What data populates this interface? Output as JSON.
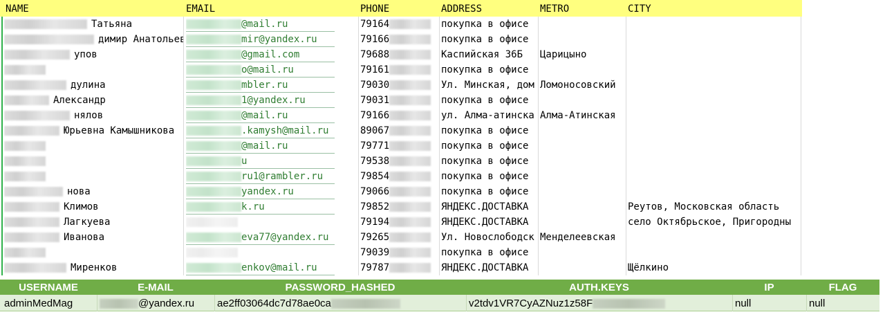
{
  "top_table": {
    "headers": [
      "NAME",
      "EMAIL",
      "PHONE",
      "ADDRESS",
      "METRO",
      "CITY"
    ],
    "rows": [
      {
        "name": "Татьяна",
        "email": "@mail.ru",
        "phone": "79164",
        "address": "покупка в офисе",
        "metro": "",
        "city": ""
      },
      {
        "name": "димир Анатольевич",
        "email": "mir@yandex.ru",
        "phone": "79166",
        "address": "покупка в офисе",
        "metro": "",
        "city": ""
      },
      {
        "name": "упов",
        "email": "@gmail.com",
        "phone": "79688",
        "address": "Каспийская 36Б",
        "metro": "Царицыно",
        "city": ""
      },
      {
        "name": "",
        "email": "o@mail.ru",
        "phone": "79161",
        "address": "покупка в офисе",
        "metro": "",
        "city": ""
      },
      {
        "name": "дулина",
        "email": "mbler.ru",
        "phone": "79030",
        "address": "Ул. Минская, дом",
        "metro": "Ломоносовский",
        "city": ""
      },
      {
        "name": "Александр",
        "email": "1@yandex.ru",
        "phone": "79031",
        "address": "покупка в офисе",
        "metro": "",
        "city": ""
      },
      {
        "name": "нялов",
        "email": "@mail.ru",
        "phone": "79166",
        "address": "ул. Алма-атинска",
        "metro": "Алма-Атинская",
        "city": ""
      },
      {
        "name": "Юрьевна Камышникова",
        "email": ".kamysh@mail.ru",
        "phone": "89067",
        "address": "покупка в офисе",
        "metro": "",
        "city": ""
      },
      {
        "name": "",
        "email": "@mail.ru",
        "phone": "79771",
        "address": "покупка в офисе",
        "metro": "",
        "city": ""
      },
      {
        "name": "",
        "email": "u",
        "phone": "79538",
        "address": "покупка в офисе",
        "metro": "",
        "city": ""
      },
      {
        "name": "",
        "email": "ru1@rambler.ru",
        "phone": "79854",
        "address": "покупка в офисе",
        "metro": "",
        "city": ""
      },
      {
        "name": "нова",
        "email": "yandex.ru",
        "phone": "79066",
        "address": "покупка в офисе",
        "metro": "",
        "city": ""
      },
      {
        "name": "Климов",
        "email": "k.ru",
        "phone": "79852",
        "address": "ЯНДЕКС.ДОСТАВКА",
        "metro": "",
        "city": "Реутов, Московская область"
      },
      {
        "name": "Лагкуева",
        "email": "",
        "phone": "79194",
        "address": "ЯНДЕКС.ДОСТАВКА",
        "metro": "",
        "city": "село Октябрьское, Пригородны"
      },
      {
        "name": "Иванова",
        "email": "eva77@yandex.ru",
        "phone": "79265",
        "address": "Ул. Новослободск",
        "metro": "Менделеевская",
        "city": ""
      },
      {
        "name": "",
        "email": "",
        "phone": "79039",
        "address": "покупка в офисе",
        "metro": "",
        "city": ""
      },
      {
        "name": "Миренков",
        "email": "enkov@mail.ru",
        "phone": "79787",
        "address": "ЯНДЕКС.ДОСТАВКА",
        "metro": "",
        "city": "Щёлкино"
      }
    ]
  },
  "bottom_table": {
    "headers": [
      "USERNAME",
      "E-MAIL",
      "PASSWORD_HASHED",
      "AUTH.KEYS",
      "IP",
      "FLAG"
    ],
    "row": {
      "username": "adminMedMag",
      "email": "@yandex.ru",
      "password_hashed": "ae2ff03064dc7d78ae0ca",
      "auth_keys": "v2tdv1VR7CyAZNuz1z58F",
      "ip": "null",
      "flag": "null"
    }
  }
}
